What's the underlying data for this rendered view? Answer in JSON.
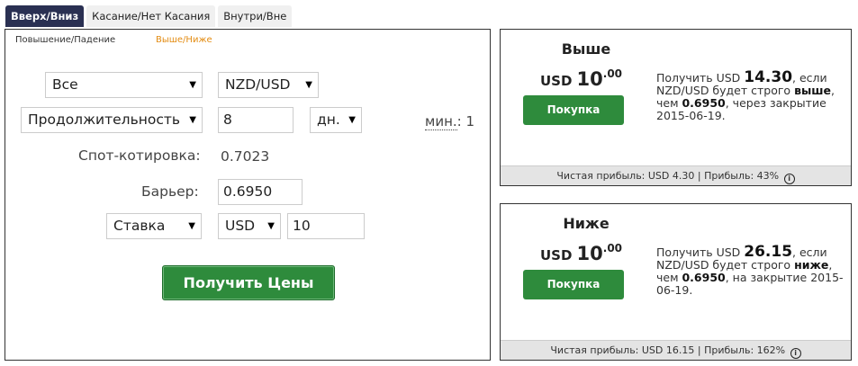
{
  "tabs": [
    {
      "label": "Вверх/Вниз",
      "active": true
    },
    {
      "label": "Касание/Нет Касания",
      "active": false
    },
    {
      "label": "Внутри/Вне",
      "active": false
    }
  ],
  "subtabs": [
    {
      "label": "Повышение/Падение",
      "active": false
    },
    {
      "label": "Выше/Ниже",
      "active": true
    }
  ],
  "form": {
    "market_select": "Все",
    "symbol_select": "NZD/USD",
    "duration_type_select": "Продолжительность",
    "duration_value": "8",
    "duration_unit_select": "дн.",
    "min_label": "мин.",
    "min_value": ": 1",
    "spot_label": "Спот-котировка:",
    "spot_value": "0.7023",
    "barrier_label": "Барьер:",
    "barrier_value": "0.6950",
    "amount_type_select": "Ставка",
    "currency_select": "USD",
    "amount_value": "10",
    "get_prices_button": "Получить Цены"
  },
  "contracts": [
    {
      "title": "Выше",
      "price_currency": "USD",
      "price_int": "10",
      "price_dec": ".00",
      "buy_button": "Покупка",
      "desc_pre": "Получить USD ",
      "payout": "14.30",
      "desc_mid1": ", если NZD/USD будет строго ",
      "direction": "выше",
      "desc_mid2": ", чем ",
      "barrier": "0.6950",
      "desc_post": ", через закрытие 2015-06-19.",
      "footer": "Чистая прибыль: USD 4.30 | Прибыль: 43%"
    },
    {
      "title": "Ниже",
      "price_currency": "USD",
      "price_int": "10",
      "price_dec": ".00",
      "buy_button": "Покупка",
      "desc_pre": "Получить USD ",
      "payout": "26.15",
      "desc_mid1": ", если NZD/USD будет строго ",
      "direction": "ниже",
      "desc_mid2": ", чем ",
      "barrier": "0.6950",
      "desc_post": ", на закрытие 2015-06-19.",
      "footer": "Чистая прибыль: USD 16.15 | Прибыль: 162%"
    }
  ],
  "icons": {
    "select_arrow": "▼",
    "info": "i"
  },
  "colors": {
    "tab_active": "#2a3052",
    "accent_orange": "#e38c13",
    "buy_green": "#2e8b3c"
  }
}
